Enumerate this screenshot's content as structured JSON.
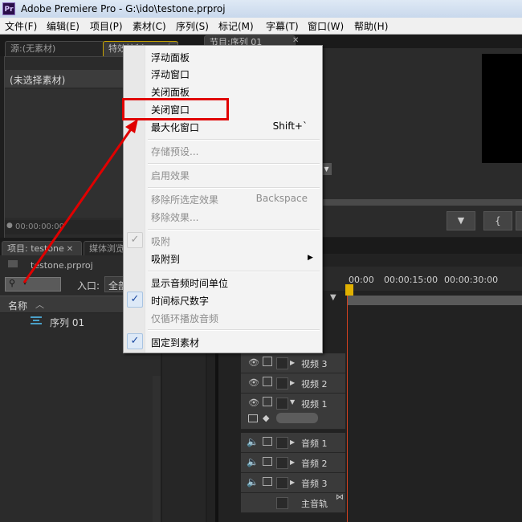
{
  "window": {
    "title": "Adobe Premiere Pro - G:\\ido\\testone.prproj",
    "logo": "Pr"
  },
  "menubar": [
    {
      "label": "文件(F)"
    },
    {
      "label": "编辑(E)"
    },
    {
      "label": "项目(P)"
    },
    {
      "label": "素材(C)"
    },
    {
      "label": "序列(S)"
    },
    {
      "label": "标记(M)"
    },
    {
      "label": "字幕(T)"
    },
    {
      "label": "窗口(W)"
    },
    {
      "label": "帮助(H)"
    }
  ],
  "source_panel": {
    "tab_source": "源:(无素材)",
    "tab_effects": "特效控制",
    "no_clip_text": "(未选择素材)",
    "timecode": "00:00:00:00"
  },
  "program_panel": {
    "tab_label": "节目:序列 01"
  },
  "project_panel": {
    "tab_project": "项目: testone",
    "tab_media": "媒体浏览",
    "file_name": "testone.prproj",
    "entry_label": "入口:",
    "entry_value": "全部",
    "col_name": "名称",
    "items": [
      {
        "name": "序列 01"
      }
    ]
  },
  "timeline": {
    "ruler": [
      "00:00",
      "00:00:15:00",
      "00:00:30:00"
    ],
    "video_tracks": [
      {
        "name": "视频 3"
      },
      {
        "name": "视频 2"
      },
      {
        "name": "视频 1"
      }
    ],
    "audio_tracks": [
      {
        "name": "音频 1"
      },
      {
        "name": "音频 2"
      },
      {
        "name": "音频 3"
      }
    ],
    "master": "主音轨"
  },
  "context_menu": {
    "items": [
      {
        "label": "浮动面板"
      },
      {
        "label": "浮动窗口"
      },
      {
        "label": "关闭面板"
      },
      {
        "label": "关闭窗口"
      },
      {
        "label": "最大化窗口",
        "shortcut": "Shift+`"
      },
      {
        "label": "存储预设..."
      },
      {
        "label": "启用效果"
      },
      {
        "label": "移除所选定效果",
        "shortcut": "Backspace"
      },
      {
        "label": "移除效果..."
      },
      {
        "label": "吸附"
      },
      {
        "label": "吸附到"
      },
      {
        "label": "显示音频时间单位"
      },
      {
        "label": "时间标尺数字"
      },
      {
        "label": "仅循环播放音频"
      },
      {
        "label": "固定到素材"
      }
    ]
  },
  "colors": {
    "annotation": "#e00000",
    "panel_bg": "#2b2b2b",
    "menu_bg": "#f3f3f3"
  }
}
